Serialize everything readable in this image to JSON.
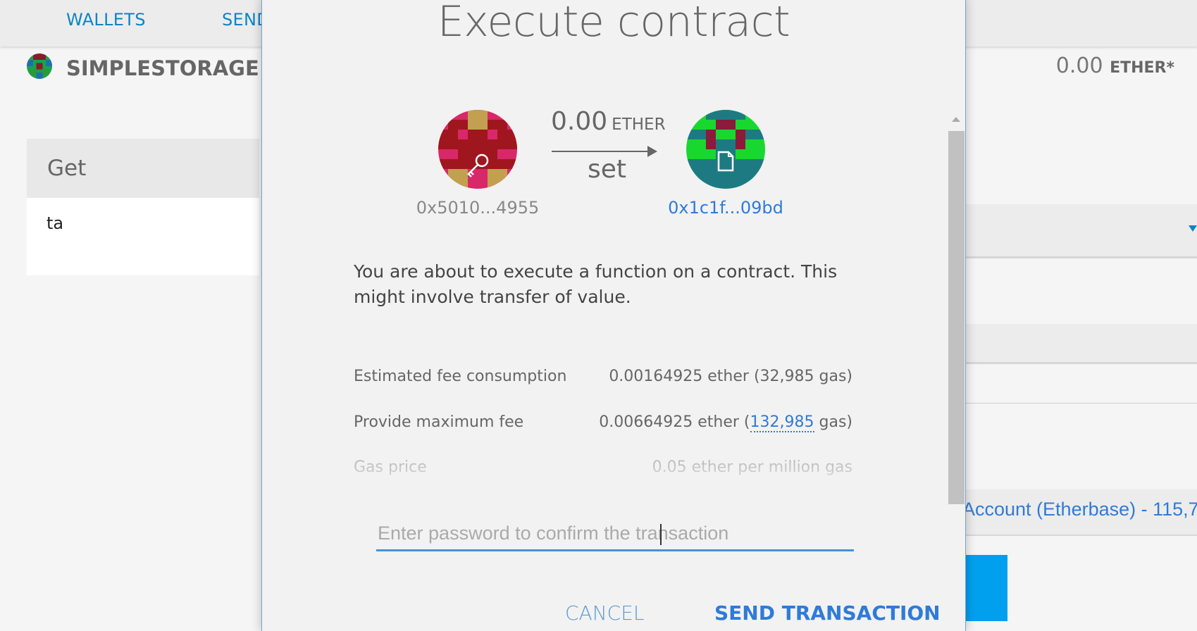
{
  "nav": {
    "wallets": "WALLETS",
    "send": "SEND"
  },
  "contract": {
    "name": "SIMPLESTORAGE"
  },
  "balance": {
    "amount": "0.00",
    "unit": "ETHER*"
  },
  "read_panel": {
    "header": "Get",
    "field": "ta"
  },
  "account_select": "Account (Etherbase) - 115,7",
  "modal": {
    "title": "Execute contract",
    "from_address": "0x5010...4955",
    "to_address": "0x1c1f...09bd",
    "amount": "0.00",
    "amount_unit": "ETHER",
    "function": "set",
    "description": "You are about to execute a function on a contract. This might involve transfer of value.",
    "estimated_fee_label": "Estimated fee consumption",
    "estimated_fee_value": "0.00164925 ether (32,985 gas)",
    "max_fee_label": "Provide maximum fee",
    "max_fee_prefix": "0.00664925 ether (",
    "max_fee_gas": "132,985",
    "max_fee_suffix": " gas)",
    "gas_price_label": "Gas price",
    "gas_price_value": "0.05 ether per million gas",
    "password_placeholder": "Enter password to confirm the transaction",
    "cancel": "CANCEL",
    "send": "SEND TRANSACTION"
  },
  "colors": {
    "link": "#0a86c4",
    "accent": "#2f7bd8",
    "primary_button": "#00a0ef"
  },
  "icons": {
    "from": "key-icon",
    "to": "document-icon"
  }
}
